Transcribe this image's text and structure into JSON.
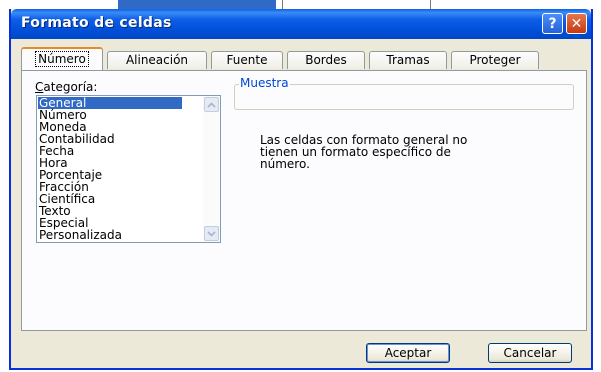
{
  "dialog": {
    "title": "Formato de celdas",
    "help_glyph": "?",
    "close_glyph": "✕"
  },
  "tabs": [
    {
      "label": "Número",
      "active": true
    },
    {
      "label": "Alineación",
      "active": false
    },
    {
      "label": "Fuente",
      "active": false
    },
    {
      "label": "Bordes",
      "active": false
    },
    {
      "label": "Tramas",
      "active": false
    },
    {
      "label": "Proteger",
      "active": false
    }
  ],
  "categoria": {
    "label_underlined": "C",
    "label_rest": "ategoría:",
    "items": [
      "General",
      "Número",
      "Moneda",
      "Contabilidad",
      "Fecha",
      "Hora",
      "Porcentaje",
      "Fracción",
      "Científica",
      "Texto",
      "Especial",
      "Personalizada"
    ],
    "selected": "General"
  },
  "muestra": {
    "label": "Muestra",
    "value": ""
  },
  "description": {
    "lines": [
      "Las celdas con formato general no",
      "tienen un formato específico de",
      "número."
    ]
  },
  "buttons": {
    "ok": "Aceptar",
    "cancel": "Cancelar"
  },
  "colors": {
    "titlebar": "#0050d8",
    "selection": "#316ac5",
    "accent_tab": "#e68b2c",
    "group_label": "#0046d5"
  }
}
